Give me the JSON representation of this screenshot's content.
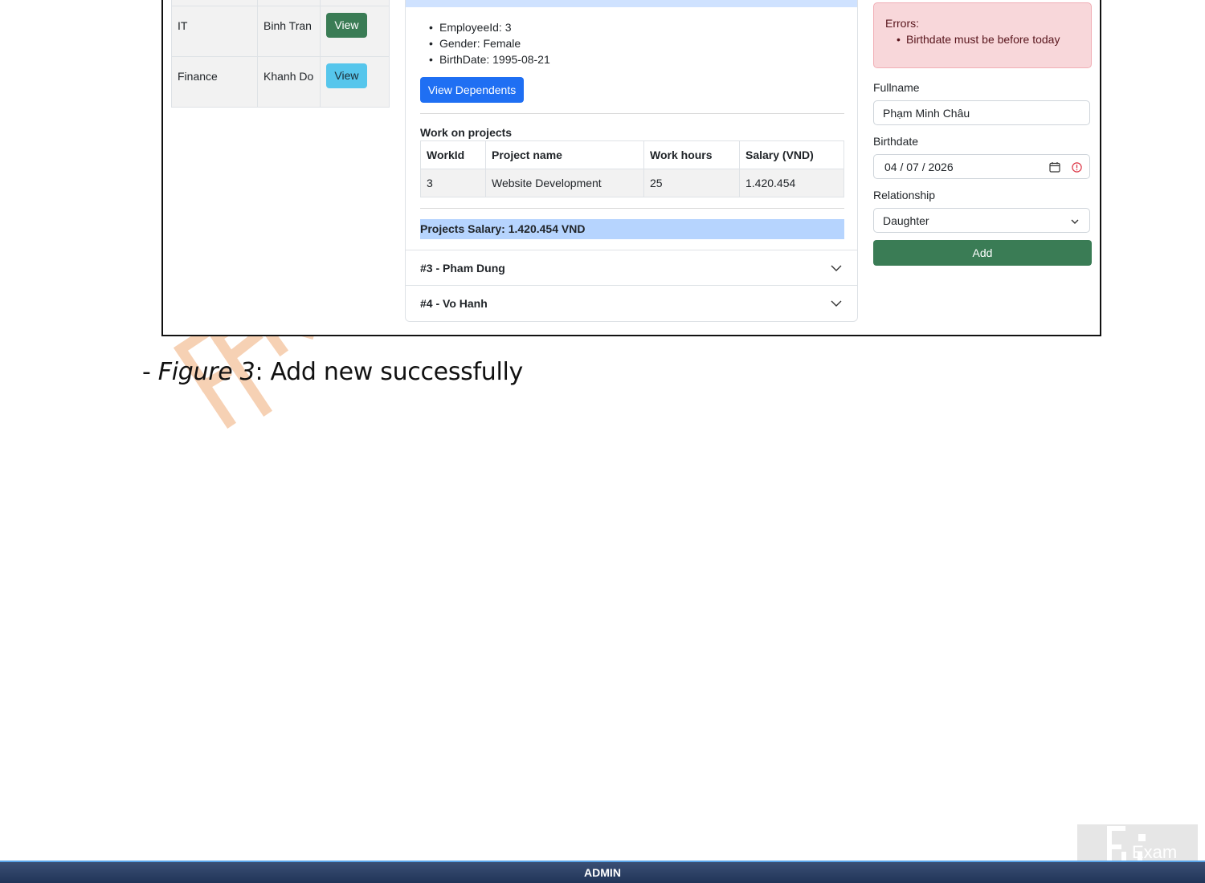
{
  "departments": [
    {
      "name": "IT",
      "manager": "Binh Tran",
      "action": "View"
    },
    {
      "name": "Finance",
      "manager": "Khanh Do",
      "action": "View"
    }
  ],
  "employee": {
    "info": [
      "EmployeeId: 3",
      "Gender: Female",
      "BirthDate: 1995-08-21"
    ],
    "view_dependents_label": "View Dependents"
  },
  "projects": {
    "heading": "Work on projects",
    "columns": [
      "WorkId",
      "Project name",
      "Work hours",
      "Salary (VND)"
    ],
    "rows": [
      [
        "3",
        "Website Development",
        "25",
        "1.420.454"
      ]
    ],
    "salary_total": "Projects Salary: 1.420.454 VND"
  },
  "accordion": [
    {
      "label": "#3 - Pham Dung"
    },
    {
      "label": "#4 - Vo Hanh"
    }
  ],
  "form": {
    "errors_title": "Errors:",
    "errors": [
      "Birthdate must be before today"
    ],
    "fullname_label": "Fullname",
    "fullname_value": "Phạm Minh Châu",
    "birthdate_label": "Birthdate",
    "birthdate_value": "04 / 07 / 2026",
    "relationship_label": "Relationship",
    "relationship_value": "Daughter",
    "add_label": "Add"
  },
  "caption": {
    "prefix": "- ",
    "figure": "Figure 3",
    "text": ": Add new successfully"
  },
  "logo": {
    "text": "Exam"
  },
  "footer": {
    "label": "ADMIN"
  },
  "colors": {
    "primary": "#1f6ff3",
    "success": "#3a7c55",
    "info": "#56c6ec",
    "danger_bg": "#f8d7da",
    "highlight": "#b6d4fe",
    "footer": "#213558"
  }
}
